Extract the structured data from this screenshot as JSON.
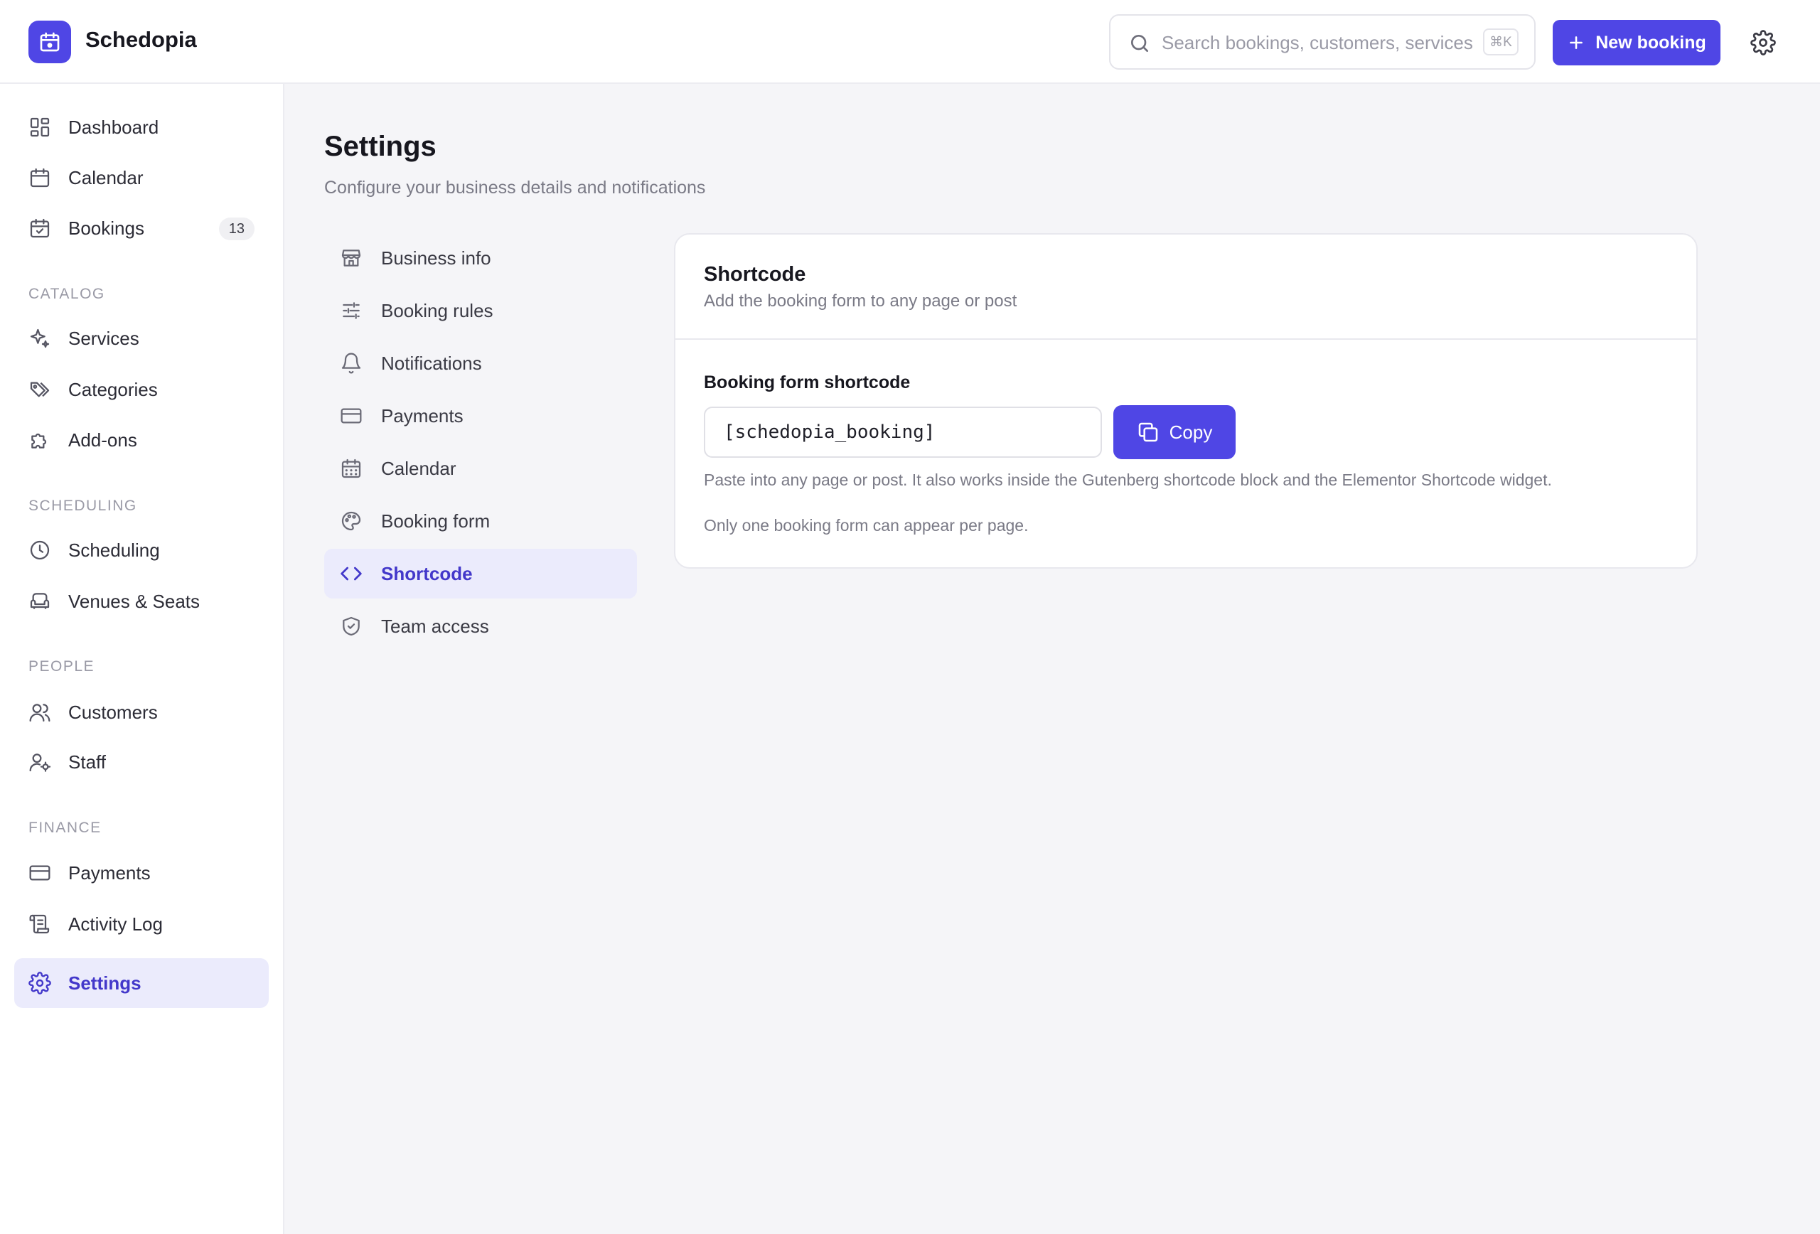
{
  "app": {
    "name": "Schedopia"
  },
  "header": {
    "search_placeholder": "Search bookings, customers, services",
    "search_shortcut": "⌘K",
    "new_booking_label": "New booking"
  },
  "sidebar": {
    "items_top": [
      {
        "label": "Dashboard",
        "icon": "dashboard-icon"
      },
      {
        "label": "Calendar",
        "icon": "calendar-icon"
      },
      {
        "label": "Bookings",
        "icon": "calendar-check-icon",
        "badge": "13"
      }
    ],
    "sections": [
      {
        "title": "CATALOG",
        "items": [
          {
            "label": "Services",
            "icon": "sparkle-icon"
          },
          {
            "label": "Categories",
            "icon": "tags-icon"
          },
          {
            "label": "Add-ons",
            "icon": "puzzle-icon"
          }
        ]
      },
      {
        "title": "SCHEDULING",
        "items": [
          {
            "label": "Scheduling",
            "icon": "clock-icon"
          },
          {
            "label": "Venues & Seats",
            "icon": "armchair-icon"
          }
        ]
      },
      {
        "title": "PEOPLE",
        "items": [
          {
            "label": "Customers",
            "icon": "users-icon"
          },
          {
            "label": "Staff",
            "icon": "user-cog-icon"
          }
        ]
      },
      {
        "title": "FINANCE",
        "items": [
          {
            "label": "Payments",
            "icon": "credit-card-icon"
          },
          {
            "label": "Activity Log",
            "icon": "scroll-icon"
          }
        ]
      }
    ],
    "active_item": {
      "label": "Settings",
      "icon": "gear-icon"
    }
  },
  "page": {
    "title": "Settings",
    "subtitle": "Configure your business details and notifications"
  },
  "settings_nav": [
    {
      "label": "Business info",
      "icon": "store-icon"
    },
    {
      "label": "Booking rules",
      "icon": "sliders-icon"
    },
    {
      "label": "Notifications",
      "icon": "bell-icon"
    },
    {
      "label": "Payments",
      "icon": "credit-card-icon"
    },
    {
      "label": "Calendar",
      "icon": "calendar-grid-icon"
    },
    {
      "label": "Booking form",
      "icon": "palette-icon"
    },
    {
      "label": "Shortcode",
      "icon": "code-icon",
      "active": true
    },
    {
      "label": "Team access",
      "icon": "shield-check-icon"
    }
  ],
  "shortcode_card": {
    "title": "Shortcode",
    "subtitle": "Add the booking form to any page or post",
    "field_label": "Booking form shortcode",
    "shortcode_value": "[schedopia_booking]",
    "copy_label": "Copy",
    "help_1": "Paste into any page or post. It also works inside the Gutenberg shortcode block and the Elementor Shortcode widget.",
    "help_2": "Only one booking form can appear per page."
  },
  "colors": {
    "accent": "#4f46e5",
    "accent_soft": "#ebebfc",
    "accent_text": "#4338ca",
    "background": "#f5f5f8"
  }
}
